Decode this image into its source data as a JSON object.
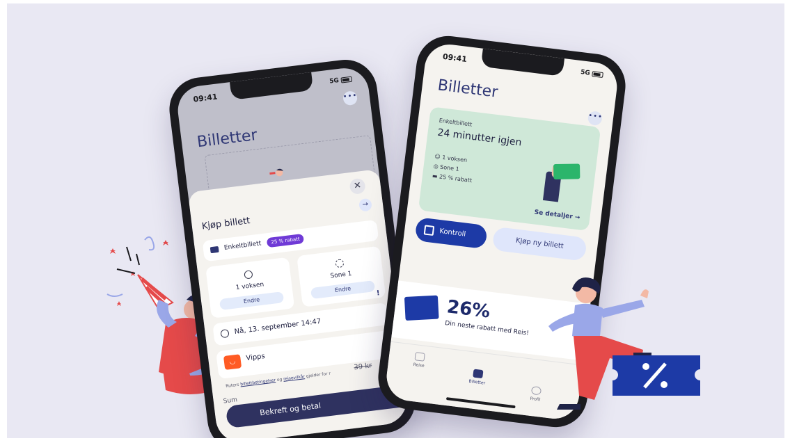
{
  "colors": {
    "background": "#e9e8f3",
    "brand_navy": "#2f3775",
    "accent_purple": "#6f3ad6",
    "control_blue": "#1d3aa6",
    "ticket_green": "#cfe8d8",
    "vipps_orange": "#ff5b24"
  },
  "left_phone": {
    "status": {
      "time": "09:41",
      "network": "5G"
    },
    "title": "Billetter",
    "more_icon": "more-dots-icon",
    "sheet": {
      "close_icon": "close-icon",
      "title": "Kjøp billett",
      "ticket_type": {
        "label": "Enkeltbillett",
        "badge": "25 % rabatt"
      },
      "traveller": {
        "label": "1 voksen",
        "button": "Endre",
        "icon": "smiley-icon"
      },
      "zone": {
        "label": "Sone 1",
        "button": "Endre",
        "icon": "location-icon"
      },
      "datetime": {
        "label": "Nå, 13. september 14:47",
        "icon": "clock-icon"
      },
      "payment": {
        "label": "Vipps",
        "icon": "vipps-logo-icon"
      },
      "terms": {
        "prefix": "Ruters",
        "link1": "billettbetingelser",
        "mid": "og",
        "link2": "reisevilkår",
        "suffix": "gjelder for r"
      },
      "old_price": "39 kr",
      "sum_label": "Sum",
      "confirm_button": "Bekreft og betal"
    }
  },
  "right_phone": {
    "status": {
      "time": "09:41",
      "network": "5G"
    },
    "title": "Billetter",
    "more_icon": "more-dots-icon",
    "active_ticket": {
      "type": "Enkeltbillett",
      "time_left": "24 minutter igjen",
      "traveller": "1 voksen",
      "zone": "Sone 1",
      "discount": "25 % rabatt",
      "details_link": "Se detaljer"
    },
    "control_button": "Kontroll",
    "buy_new_button": "Kjøp ny billett",
    "promo": {
      "percent": "26%",
      "text": "Din neste rabatt med Reis!"
    },
    "tabs": [
      {
        "label": "Reise",
        "icon": "travel-icon",
        "active": false
      },
      {
        "label": "Billetter",
        "icon": "ticket-icon",
        "active": true
      },
      {
        "label": "Profil",
        "icon": "profile-icon",
        "active": false
      }
    ]
  },
  "illustrations": {
    "left": "party-woman-illustration",
    "right": "pointing-woman-discount-ticket-illustration"
  }
}
